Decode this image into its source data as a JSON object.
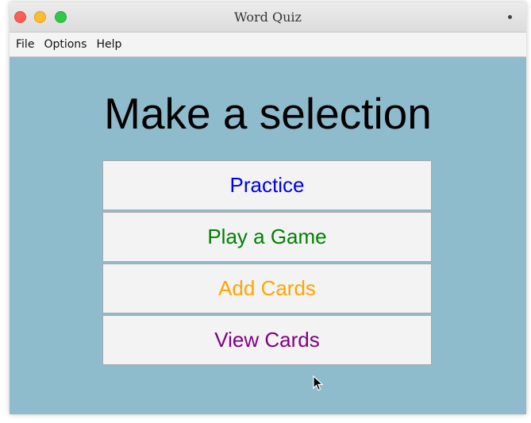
{
  "window": {
    "title": "Word Quiz"
  },
  "menu": {
    "items": [
      "File",
      "Options",
      "Help"
    ]
  },
  "main": {
    "heading": "Make a selection",
    "buttons": [
      {
        "label": "Practice",
        "color": "#0000ee"
      },
      {
        "label": "Play a Game",
        "color": "#008000"
      },
      {
        "label": "Add Cards",
        "color": "#ffa500"
      },
      {
        "label": "View Cards",
        "color": "#800080"
      }
    ]
  },
  "colors": {
    "background": "#8fbccc"
  }
}
